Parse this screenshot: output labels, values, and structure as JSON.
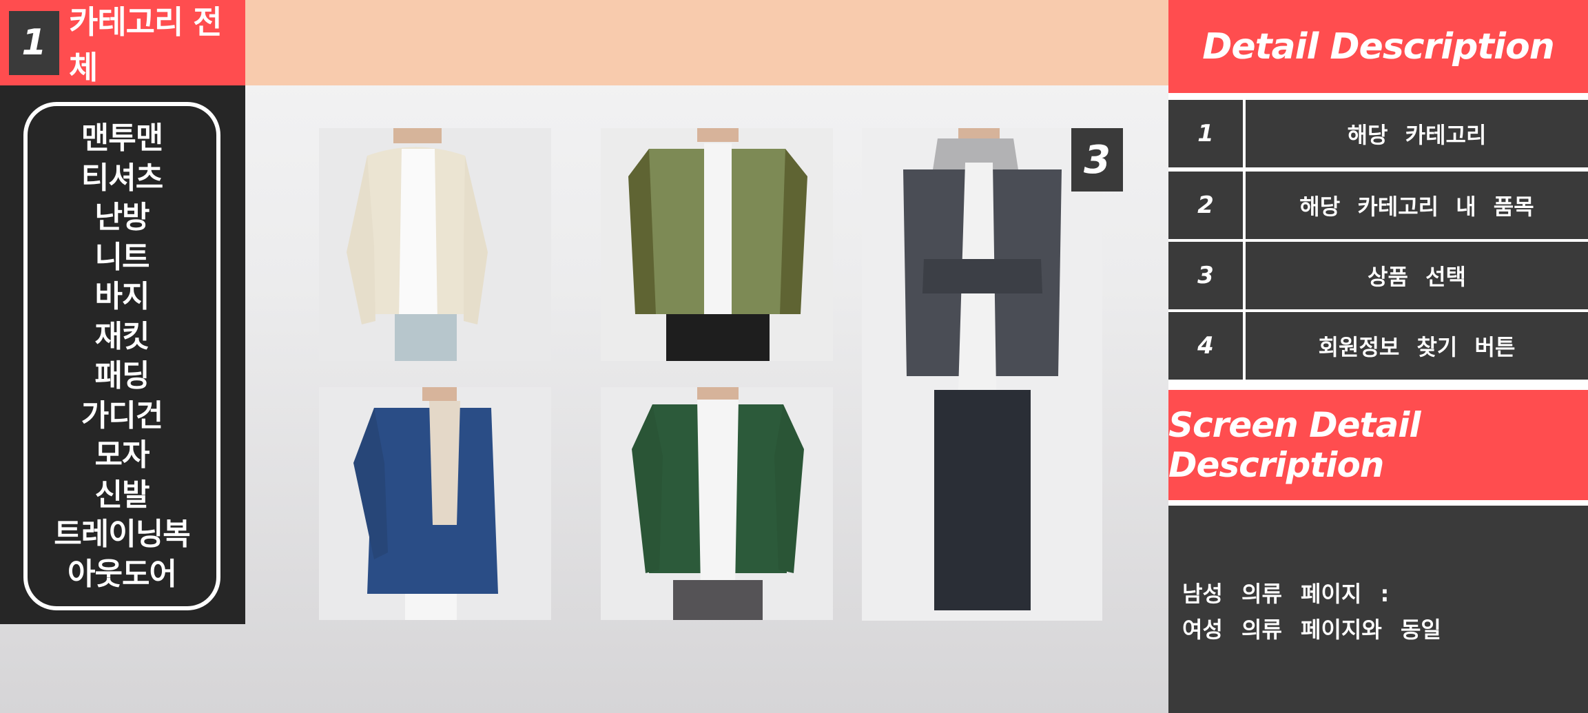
{
  "category_header": {
    "number": "1",
    "title": "카테고리 전체"
  },
  "sidebar": {
    "items": [
      {
        "label": "맨투맨"
      },
      {
        "label": "티셔츠"
      },
      {
        "label": "난방"
      },
      {
        "label": "니트"
      },
      {
        "label": "바지"
      },
      {
        "label": "재킷"
      },
      {
        "label": "패딩"
      },
      {
        "label": "가디건"
      },
      {
        "label": "모자"
      },
      {
        "label": "신발"
      },
      {
        "label": "트레이닝복"
      },
      {
        "label": "아웃도어"
      }
    ]
  },
  "products": [
    {
      "name": "cream-cardigan-product-image"
    },
    {
      "name": "khaki-jacket-product-image"
    },
    {
      "name": "denim-jacket-product-image"
    },
    {
      "name": "navy-coat-product-image"
    },
    {
      "name": "green-cardigan-product-image"
    }
  ],
  "selected_badge": "3",
  "detail": {
    "title": "Detail Description",
    "rows": [
      {
        "num": "1",
        "desc": "해당 카테고리"
      },
      {
        "num": "2",
        "desc": "해당 카테고리 내 품목"
      },
      {
        "num": "3",
        "desc": "상품 선택"
      },
      {
        "num": "4",
        "desc": "회원정보 찾기 버튼"
      }
    ]
  },
  "screen_detail": {
    "title": "Screen Detail Description",
    "lines": [
      "남성 의류 페이지 :",
      "여성 의류 페이지와 동일"
    ]
  },
  "colors": {
    "accent_red": "#ff4d4f",
    "peach": "#f8cbad",
    "dark": "#3a3a3a",
    "sidebar_dark": "#262626"
  }
}
